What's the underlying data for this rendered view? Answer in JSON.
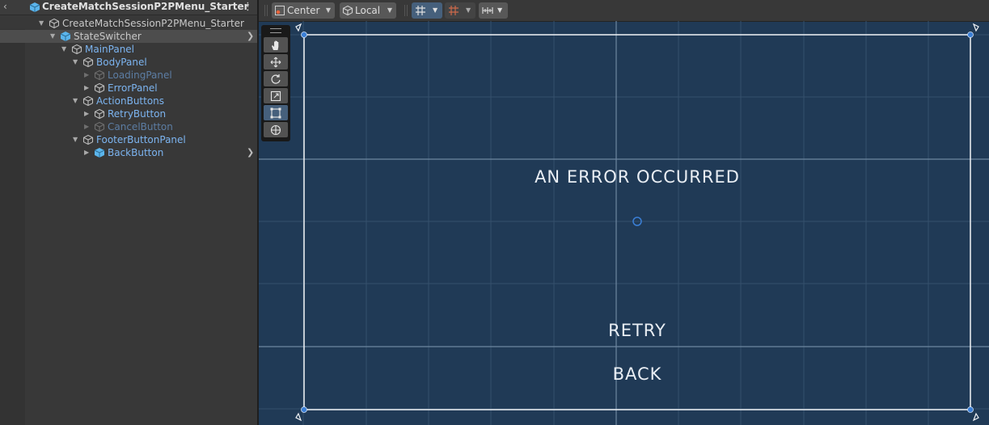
{
  "hierarchy": {
    "title": "CreateMatchSessionP2PMenu_Starter",
    "items": [
      {
        "label": "CreateMatchSessionP2PMenu_Starter",
        "style": "root"
      },
      {
        "label": "StateSwitcher",
        "style": "prefab"
      },
      {
        "label": "MainPanel",
        "style": "blue"
      },
      {
        "label": "BodyPanel",
        "style": "blue"
      },
      {
        "label": "LoadingPanel",
        "style": "dim"
      },
      {
        "label": "ErrorPanel",
        "style": "blue"
      },
      {
        "label": "ActionButtons",
        "style": "blue"
      },
      {
        "label": "RetryButton",
        "style": "blue"
      },
      {
        "label": "CancelButton",
        "style": "dim"
      },
      {
        "label": "FooterButtonPanel",
        "style": "blue"
      },
      {
        "label": "BackButton",
        "style": "prefab"
      }
    ]
  },
  "toolbar": {
    "pivot_label": "Center",
    "space_label": "Local"
  },
  "canvas": {
    "title": "AN ERROR OCCURRED",
    "retry_label": "RETRY",
    "back_label": "BACK"
  },
  "tools": [
    "hand-tool",
    "move-tool",
    "rotate-tool",
    "scale-tool",
    "rect-tool",
    "transform-tool"
  ],
  "colors": {
    "scene_bg": "#203a56",
    "selection_blue": "#7cb4f0",
    "prefab_blue": "#7ac4ee",
    "panel_bg": "#383838"
  }
}
